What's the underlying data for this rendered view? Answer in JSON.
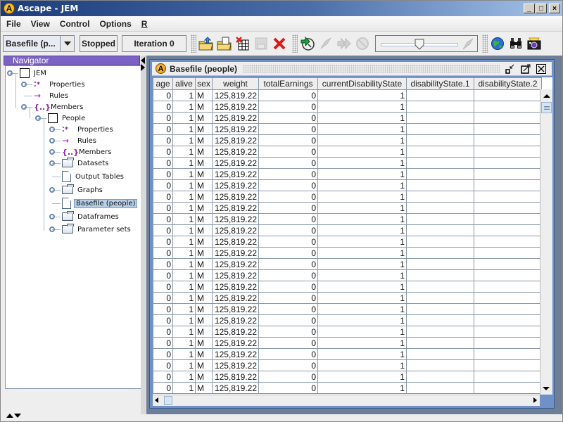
{
  "window": {
    "title": "Ascape - JEM",
    "logo_letter": "A",
    "controls": {
      "minimize": "_",
      "maximize": "□",
      "close": "×"
    }
  },
  "menubar": {
    "items": [
      "File",
      "View",
      "Control",
      "Options",
      "R"
    ]
  },
  "toolbar": {
    "view_select": {
      "value": "Basefile (p..."
    },
    "run_status": "Stopped",
    "iteration": "Iteration 0",
    "buttons": [
      {
        "name": "open-icon",
        "enabled": true
      },
      {
        "name": "open-saved-icon",
        "enabled": true
      },
      {
        "name": "new-table-icon",
        "enabled": true
      },
      {
        "name": "save-icon",
        "enabled": false
      },
      {
        "name": "delete-icon",
        "enabled": true
      },
      {
        "name": "start-icon",
        "enabled": true
      },
      {
        "name": "step-icon",
        "enabled": false
      },
      {
        "name": "fast-forward-icon",
        "enabled": false
      },
      {
        "name": "stop-icon",
        "enabled": false
      },
      {
        "name": "globe-icon",
        "enabled": true
      },
      {
        "name": "binoculars-icon",
        "enabled": true
      },
      {
        "name": "camera-icon",
        "enabled": true
      }
    ],
    "speed_slider_fraction": 0.5
  },
  "navigator": {
    "title": "Navigator",
    "tree": [
      {
        "label": "JEM",
        "icon": "box"
      },
      {
        "label": "Properties",
        "icon": "properties"
      },
      {
        "label": "Rules",
        "icon": "rules"
      },
      {
        "label": "Members",
        "icon": "members"
      },
      {
        "label": "People",
        "icon": "box"
      },
      {
        "label": "Properties",
        "icon": "properties"
      },
      {
        "label": "Rules",
        "icon": "rules"
      },
      {
        "label": "Members",
        "icon": "members"
      },
      {
        "label": "Datasets",
        "icon": "folder"
      },
      {
        "label": "Output Tables",
        "icon": "doc"
      },
      {
        "label": "Graphs",
        "icon": "folder"
      },
      {
        "label": "Basefile (people)",
        "icon": "doc",
        "selected": true
      },
      {
        "label": "Dataframes",
        "icon": "folder"
      },
      {
        "label": "Parameter sets",
        "icon": "folder"
      }
    ]
  },
  "table_window": {
    "title": "Basefile (people)",
    "logo_letter": "A",
    "columns": [
      "age",
      "alive",
      "sex",
      "weight",
      "totalEarnings",
      "currentDisabilityState",
      "disabilityState.1",
      "disabilityState.2"
    ],
    "row_template": [
      "0",
      "1",
      "M",
      "125,819.22",
      "0",
      "1",
      "",
      ""
    ],
    "visible_row_count": 27
  }
}
